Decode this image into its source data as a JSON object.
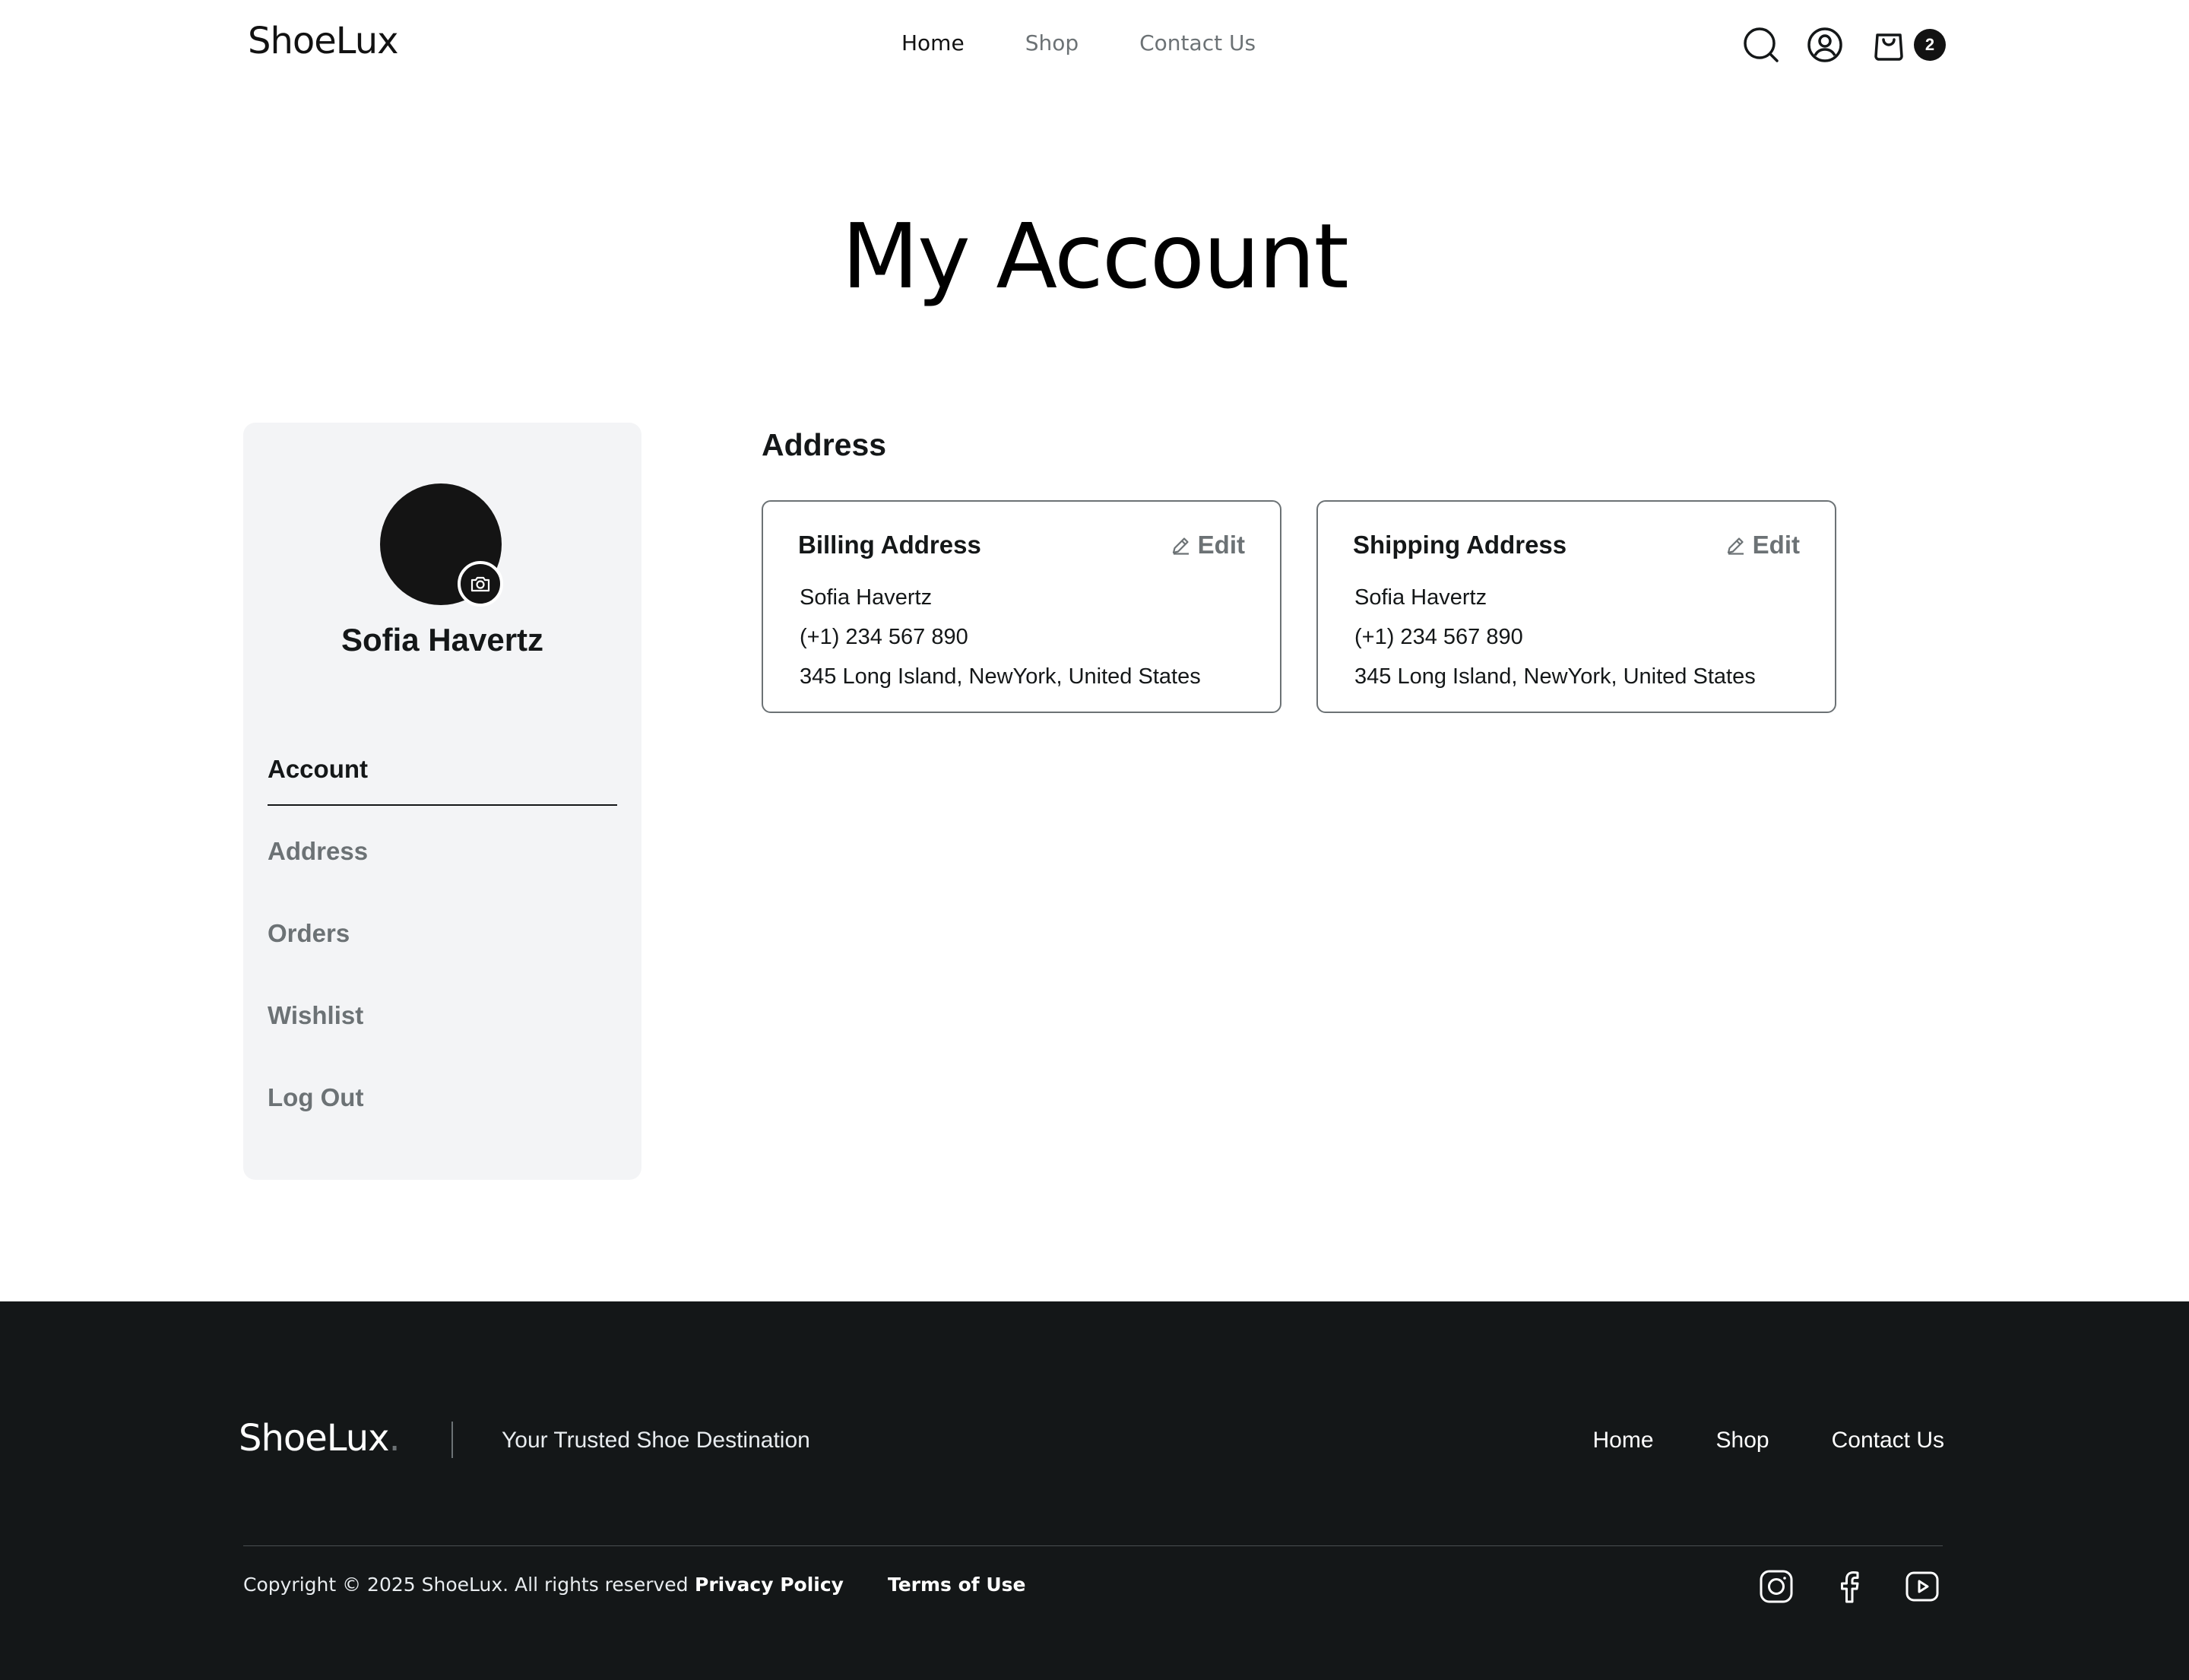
{
  "header": {
    "logo": "ShoeLux",
    "nav": [
      {
        "label": "Home",
        "active": true
      },
      {
        "label": "Shop",
        "active": false
      },
      {
        "label": "Contact Us",
        "active": false
      }
    ],
    "cart_count": "2",
    "icons": [
      "search-icon",
      "user-icon",
      "shopping-bag-icon"
    ]
  },
  "page": {
    "title": "My Account"
  },
  "sidebar": {
    "user_name": "Sofia Havertz",
    "items": [
      {
        "label": "Account",
        "active": true
      },
      {
        "label": "Address",
        "active": false
      },
      {
        "label": "Orders",
        "active": false
      },
      {
        "label": "Wishlist",
        "active": false
      },
      {
        "label": "Log Out",
        "active": false
      }
    ]
  },
  "address": {
    "section_title": "Address",
    "edit_label": "Edit",
    "billing": {
      "title": "Billing Address",
      "name": "Sofia Havertz",
      "phone": "(+1) 234 567 890",
      "address": "345 Long Island, NewYork, United States"
    },
    "shipping": {
      "title": "Shipping Address",
      "name": "Sofia Havertz",
      "phone": "(+1) 234 567 890",
      "address": "345 Long Island, NewYork, United States"
    }
  },
  "footer": {
    "logo": "ShoeLux",
    "logo_dot": ".",
    "tagline": "Your Trusted Shoe Destination",
    "nav": [
      "Home",
      "Shop",
      "Contact Us"
    ],
    "copyright": "Copyright © 2025 ShoeLux. All rights reserved",
    "privacy": "Privacy Policy",
    "terms": "Terms of Use",
    "social_icons": [
      "instagram-icon",
      "facebook-icon",
      "youtube-icon"
    ]
  },
  "colors": {
    "primary": "#141718",
    "muted": "#6c7275",
    "sidebar_bg": "#f3f4f6",
    "footer_bg": "#141718"
  }
}
